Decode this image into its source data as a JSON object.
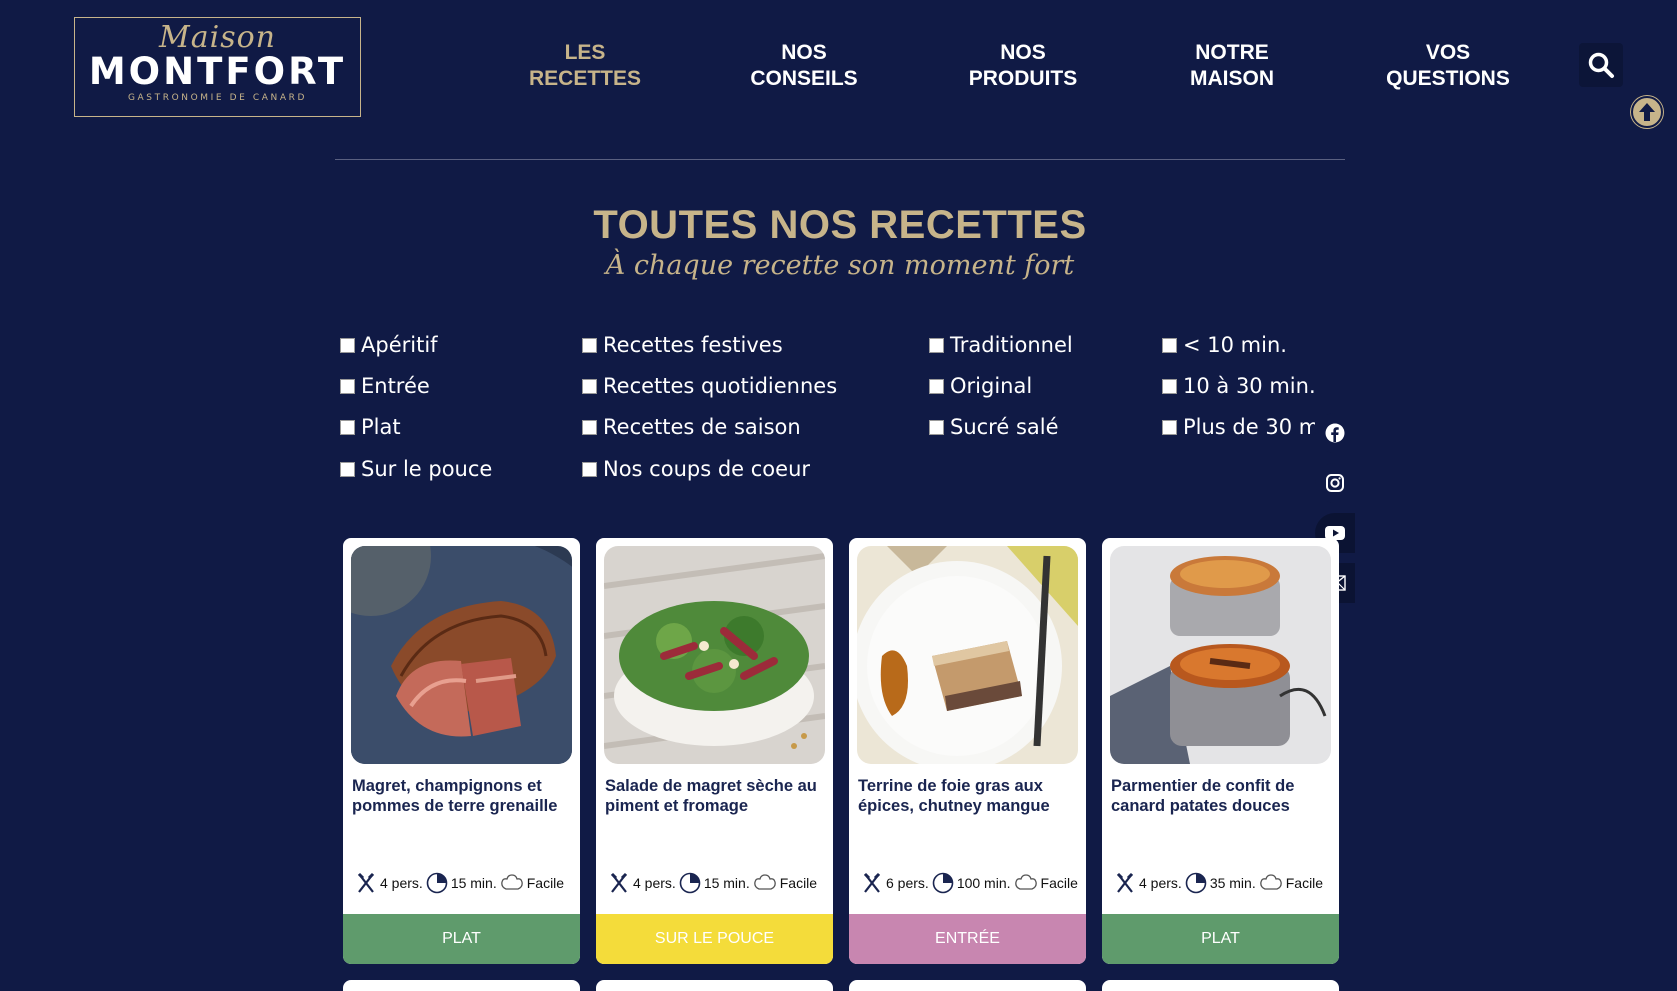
{
  "logo": {
    "script": "Maison",
    "brand": "MONTFORT",
    "tagline": "GASTRONOMIE DE CANARD"
  },
  "nav": [
    {
      "line1": "LES",
      "line2": "RECETTES",
      "active": true
    },
    {
      "line1": "NOS",
      "line2": "CONSEILS"
    },
    {
      "line1": "NOS",
      "line2": "PRODUITS"
    },
    {
      "line1": "NOTRE",
      "line2": "MAISON"
    },
    {
      "line1": "VOS",
      "line2": "QUESTIONS"
    }
  ],
  "heading": {
    "title": "TOUTES NOS RECETTES",
    "subtitle": "À chaque recette son moment fort"
  },
  "filters": {
    "course": [
      "Apéritif",
      "Entrée",
      "Plat",
      "Sur le pouce"
    ],
    "occasion": [
      "Recettes festives",
      "Recettes quotidiennes",
      "Recettes de saison",
      "Nos coups de coeur"
    ],
    "style": [
      "Traditionnel",
      "Original",
      "Sucré salé"
    ],
    "duration": [
      "< 10 min.",
      "10 à 30 min.",
      "Plus de 30 min."
    ]
  },
  "social": [
    "facebook-icon",
    "instagram-icon",
    "youtube-icon",
    "mail-icon"
  ],
  "recipes": [
    {
      "title": "Magret, champignons et pommes de terre grenaille",
      "people": "4 pers.",
      "time": "15 min.",
      "level": "Facile",
      "category": "PLAT",
      "color": "#5f9b6c"
    },
    {
      "title": "Salade de magret sèche au piment et fromage",
      "people": "4 pers.",
      "time": "15 min.",
      "level": "Facile",
      "category": "SUR LE POUCE",
      "color": "#f4dc3a"
    },
    {
      "title": "Terrine de foie gras aux épices, chutney mangue",
      "people": "6 pers.",
      "time": "100 min.",
      "level": "Facile",
      "category": "ENTRÉE",
      "color": "#c886b0"
    },
    {
      "title": "Parmentier de confit de canard patates douces",
      "people": "4 pers.",
      "time": "35 min.",
      "level": "Facile",
      "category": "PLAT",
      "color": "#5f9b6c"
    }
  ],
  "colors": {
    "background": "#101a45",
    "gold": "#c7b48a"
  }
}
